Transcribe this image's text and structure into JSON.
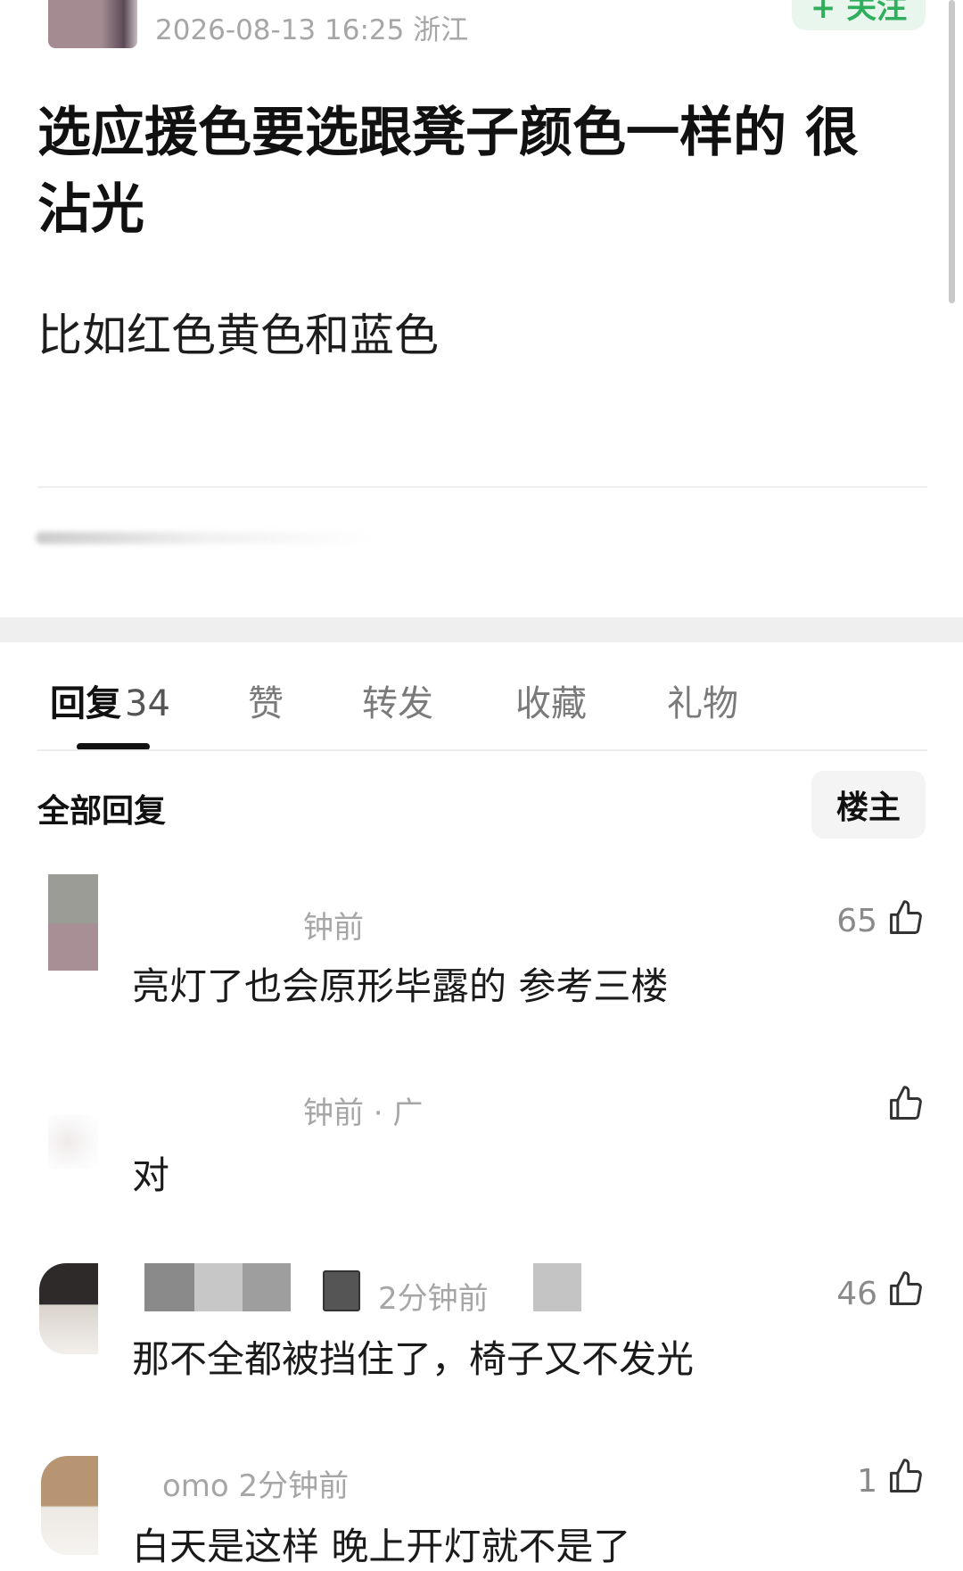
{
  "post": {
    "meta": "2026-08-13 16:25  浙江",
    "follow_label": "+ 关注",
    "title": "选应援色要选跟凳子颜色一样的 很沾光",
    "body": "比如红色黄色和蓝色"
  },
  "tabs": [
    {
      "label": "回复",
      "count": "34",
      "active": true
    },
    {
      "label": "赞"
    },
    {
      "label": "转发"
    },
    {
      "label": "收藏"
    },
    {
      "label": "礼物"
    }
  ],
  "replies_header": {
    "title": "全部回复",
    "op_filter": "楼主"
  },
  "comments": [
    {
      "meta": "钟前",
      "text": "亮灯了也会原形毕露的 参考三楼",
      "likes": "65"
    },
    {
      "meta": "钟前 · 广",
      "text": "对",
      "likes": ""
    },
    {
      "meta": "2分钟前",
      "text": "那不全都被挡住了，椅子又不发光",
      "likes": "46"
    },
    {
      "meta": "omo  2分钟前",
      "text": "白天是这样 晚上开灯就不是了",
      "likes": "1"
    }
  ],
  "colors": {
    "accent_green": "#2fae5b",
    "follow_bg": "#e9f6ee",
    "meta_gray": "#a6a6a6"
  }
}
